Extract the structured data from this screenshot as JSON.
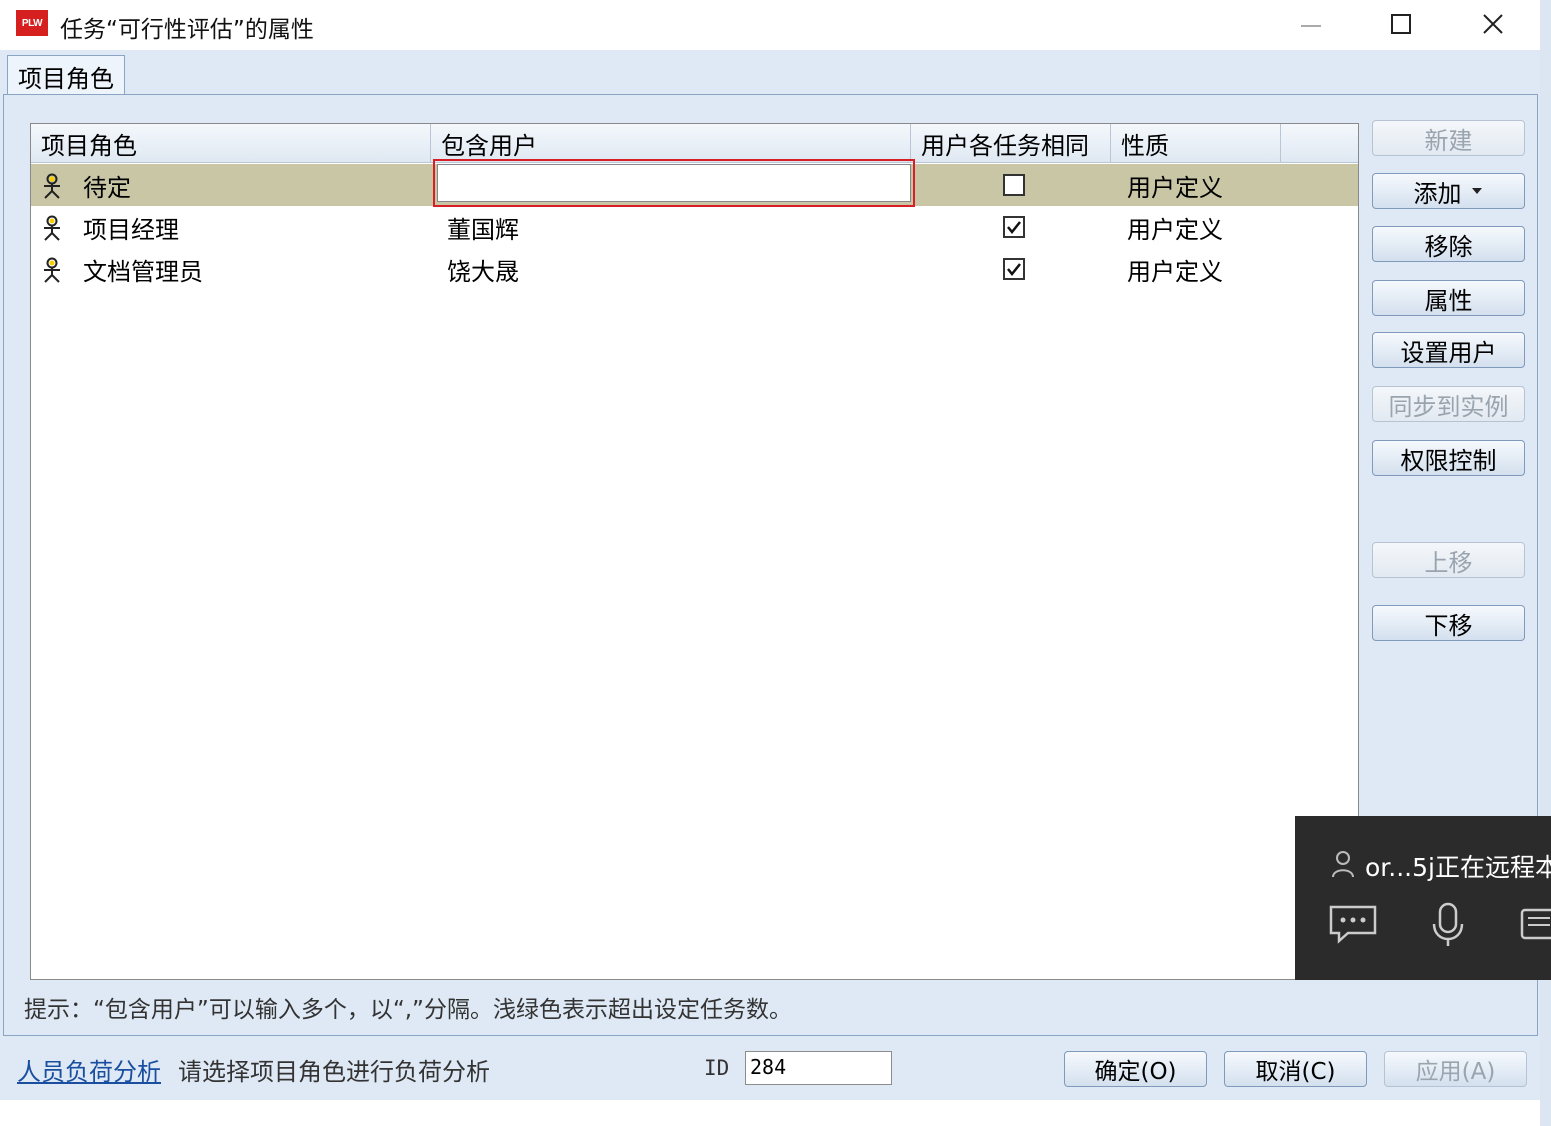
{
  "window": {
    "title": "任务“可行性评估”的属性",
    "logo_text": "PLW"
  },
  "tabs": [
    {
      "label": "项目角色"
    }
  ],
  "grid": {
    "columns": [
      "项目角色",
      "包含用户",
      "用户各任务相同",
      "性质"
    ],
    "rows": [
      {
        "role": "待定",
        "users": "",
        "same_for_all": false,
        "nature": "用户定义",
        "selected": true
      },
      {
        "role": "项目经理",
        "users": "董国辉",
        "same_for_all": true,
        "nature": "用户定义",
        "selected": false
      },
      {
        "role": "文档管理员",
        "users": "饶大晟",
        "same_for_all": true,
        "nature": "用户定义",
        "selected": false
      }
    ]
  },
  "side_buttons": {
    "new": "新建",
    "add": "添加",
    "remove": "移除",
    "properties": "属性",
    "set_user": "设置用户",
    "sync": "同步到实例",
    "permission": "权限控制",
    "move_up": "上移",
    "move_down": "下移"
  },
  "hint": "提示：“包含用户”可以输入多个，以“,”分隔。浅绿色表示超出设定任务数。",
  "footer": {
    "link": "人员负荷分析",
    "message": "请选择项目角色进行负荷分析",
    "id_label": "ID",
    "id_value": "284",
    "ok": "确定(O)",
    "cancel": "取消(C)",
    "apply": "应用(A)"
  },
  "remote_overlay": {
    "text": "or...5j正在远程本"
  },
  "colors": {
    "selected_row": "#c9c6a6",
    "highlight_border": "#d81f26",
    "window_bg": "#dfe9f5"
  }
}
